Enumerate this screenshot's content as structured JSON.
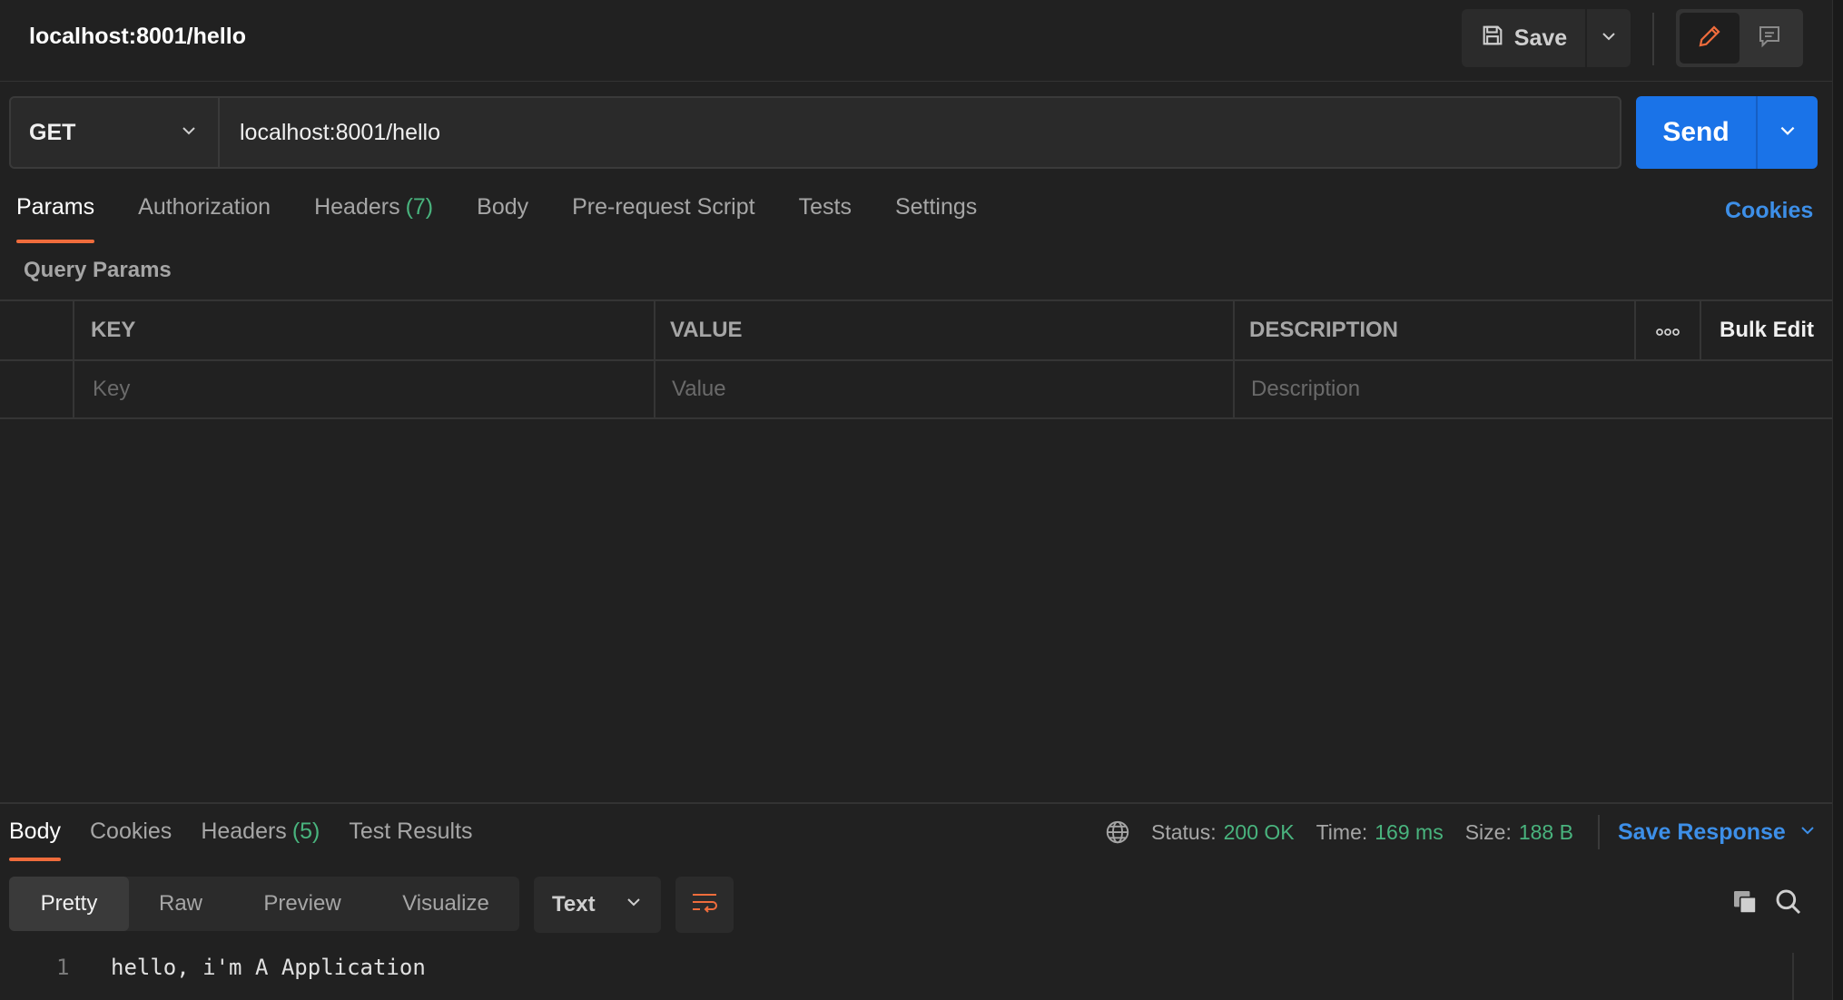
{
  "request": {
    "title": "localhost:8001/hello",
    "method": "GET",
    "url": "localhost:8001/hello"
  },
  "toolbar": {
    "save_label": "Save",
    "send_label": "Send"
  },
  "request_tabs": {
    "params": "Params",
    "authorization": "Authorization",
    "headers": "Headers",
    "headers_count": "(7)",
    "body": "Body",
    "prerequest": "Pre-request Script",
    "tests": "Tests",
    "settings": "Settings",
    "cookies": "Cookies"
  },
  "params": {
    "section_label": "Query Params",
    "columns": {
      "key": "KEY",
      "value": "VALUE",
      "description": "DESCRIPTION",
      "bulk_edit": "Bulk Edit"
    },
    "placeholders": {
      "key": "Key",
      "value": "Value",
      "description": "Description"
    }
  },
  "response": {
    "tabs": {
      "body": "Body",
      "cookies": "Cookies",
      "headers": "Headers",
      "headers_count": "(5)",
      "test_results": "Test Results"
    },
    "status_label": "Status:",
    "status_value": "200 OK",
    "time_label": "Time:",
    "time_value": "169 ms",
    "size_label": "Size:",
    "size_value": "188 B",
    "save_response": "Save Response",
    "views": {
      "pretty": "Pretty",
      "raw": "Raw",
      "preview": "Preview",
      "visualize": "Visualize"
    },
    "format": "Text",
    "line_number": "1",
    "body_text": "hello, i'm A Application"
  },
  "colors": {
    "accent_orange": "#ef6c3c",
    "link_blue": "#3d8fe8",
    "send_blue": "#1a73e8",
    "success_green": "#49b47e",
    "background": "#212121"
  }
}
